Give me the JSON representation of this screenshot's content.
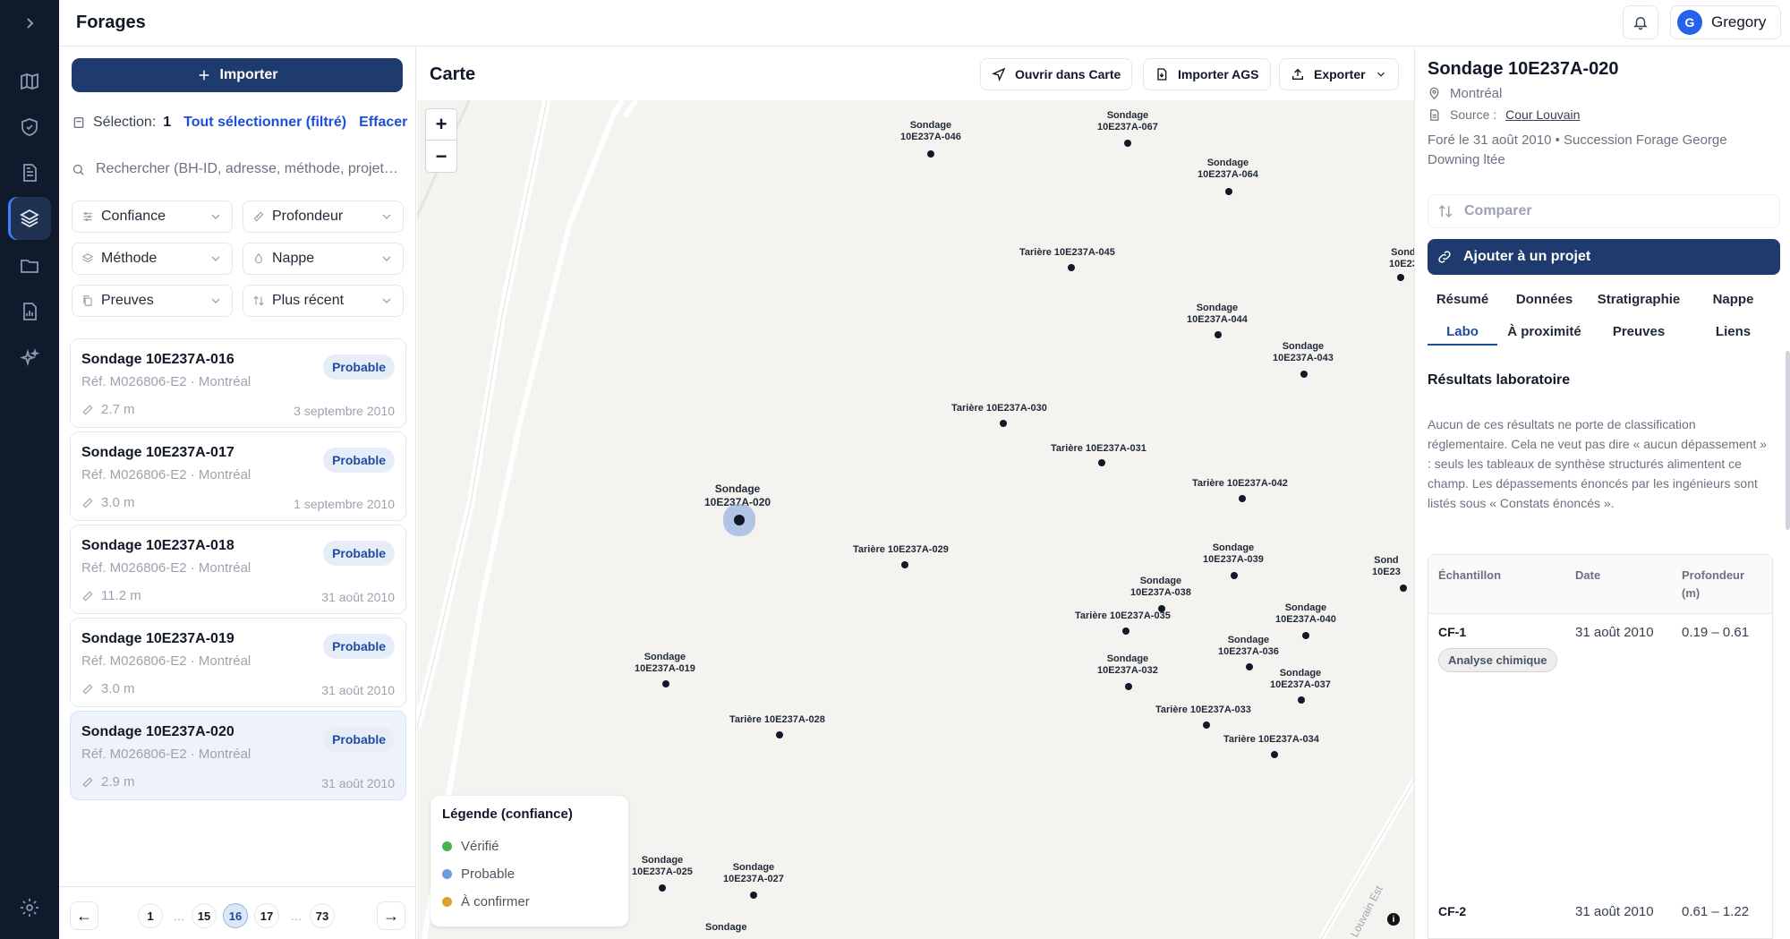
{
  "header": {
    "title": "Forages",
    "user_initial": "G",
    "user_name": "Gregory"
  },
  "left": {
    "import_label": "Importer",
    "selection_label": "Sélection:",
    "selection_count": "1",
    "select_all_label": "Tout sélectionner (filtré)",
    "clear_label": "Effacer",
    "search_placeholder": "Rechercher (BH-ID, adresse, méthode, projet…",
    "filters": [
      "Confiance",
      "Profondeur",
      "Méthode",
      "Nappe",
      "Preuves",
      "Plus récent"
    ],
    "cards": [
      {
        "title": "Sondage 10E237A-016",
        "ref": "Réf. M026806-E2 · Montréal",
        "depth": "2.7 m",
        "date": "3 septembre 2010",
        "badge": "Probable"
      },
      {
        "title": "Sondage 10E237A-017",
        "ref": "Réf. M026806-E2 · Montréal",
        "depth": "3.0 m",
        "date": "1 septembre 2010",
        "badge": "Probable"
      },
      {
        "title": "Sondage 10E237A-018",
        "ref": "Réf. M026806-E2 · Montréal",
        "depth": "11.2 m",
        "date": "31 août 2010",
        "badge": "Probable"
      },
      {
        "title": "Sondage 10E237A-019",
        "ref": "Réf. M026806-E2 · Montréal",
        "depth": "3.0 m",
        "date": "31 août 2010",
        "badge": "Probable"
      },
      {
        "title": "Sondage 10E237A-020",
        "ref": "Réf. M026806-E2 · Montréal",
        "depth": "2.9 m",
        "date": "31 août 2010",
        "badge": "Probable"
      }
    ],
    "pager": {
      "prev": "←",
      "next": "→",
      "pages": [
        "1",
        "…",
        "15",
        "16",
        "17",
        "…",
        "73"
      ]
    }
  },
  "map": {
    "title": "Carte",
    "open_label": "Ouvrir dans Carte",
    "import_ags_label": "Importer AGS",
    "export_label": "Exporter",
    "zoom_in": "+",
    "zoom_out": "−",
    "legend": {
      "title": "Légende (confiance)",
      "items": [
        "Vérifié",
        "Probable",
        "À confirmer"
      ],
      "colors": [
        "#4caf50",
        "#6b9be0",
        "#e0a030"
      ]
    },
    "street_label": "Louvain Est",
    "info": "i",
    "labels": {
      "s046": [
        "Sondage",
        "10E237A-046"
      ],
      "s067": [
        "Sondage",
        "10E237A-067"
      ],
      "s064": [
        "Sondage",
        "10E237A-064"
      ],
      "t045": "Tarière 10E237A-045",
      "s044": [
        "Sondage",
        "10E237A-044"
      ],
      "s043": [
        "Sondage",
        "10E237A-043"
      ],
      "t030": "Tarière 10E237A-030",
      "t031": "Tarière 10E237A-031",
      "t042": "Tarière 10E237A-042",
      "s020": [
        "Sondage",
        "10E237A-020"
      ],
      "t029": "Tarière 10E237A-029",
      "s039": [
        "Sondage",
        "10E237A-039"
      ],
      "s038": [
        "Sondage",
        "10E237A-038"
      ],
      "t035": "Tarière 10E237A-035",
      "s040": [
        "Sondage",
        "10E237A-040"
      ],
      "s036": [
        "Sondage",
        "10E237A-036"
      ],
      "s032": [
        "Sondage",
        "10E237A-032"
      ],
      "s037": [
        "Sondage",
        "10E237A-037"
      ],
      "s019": [
        "Sondage",
        "10E237A-019"
      ],
      "t033": "Tarière 10E237A-033",
      "t028": "Tarière 10E237A-028",
      "t034": "Tarière 10E237A-034",
      "s025": [
        "Sondage",
        "10E237A-025"
      ],
      "s027": [
        "Sondage",
        "10E237A-027"
      ],
      "s_cut_top": [
        "Sond",
        "10E23"
      ],
      "s_cut_mid": [
        "Sond",
        "10E23"
      ],
      "s_bottom": "Sondage"
    }
  },
  "detail": {
    "title": "Sondage 10E237A-020",
    "location": "Montréal",
    "source_label": "Source :",
    "source_link": "Cour Louvain",
    "description": "Foré le 31 août 2010 • Succession Forage George Downing ltée",
    "compare_label": "Comparer",
    "add_project_label": "Ajouter à un projet",
    "tabs": [
      "Résumé",
      "Données",
      "Stratigraphie",
      "Nappe",
      "Labo",
      "À proximité",
      "Preuves",
      "Liens"
    ],
    "section_title": "Résultats laboratoire",
    "section_text": "Aucun de ces résultats ne porte de classification réglementaire. Cela ne veut pas dire « aucun dépassement » : seuls les tableaux de synthèse structurés alimentent ce champ. Les dépassements énoncés par les ingénieurs sont listés sous « Constats énoncés ».",
    "table": {
      "headers": [
        "Échantillon",
        "Date",
        "Profondeur (m)"
      ],
      "rows": [
        {
          "sample": "CF-1",
          "date": "31 août 2010",
          "depth": "0.19 – 0.61",
          "tag": "Analyse chimique"
        },
        {
          "sample": "CF-2",
          "date": "31 août 2010",
          "depth": "0.61 – 1.22",
          "tag": ""
        }
      ]
    }
  }
}
